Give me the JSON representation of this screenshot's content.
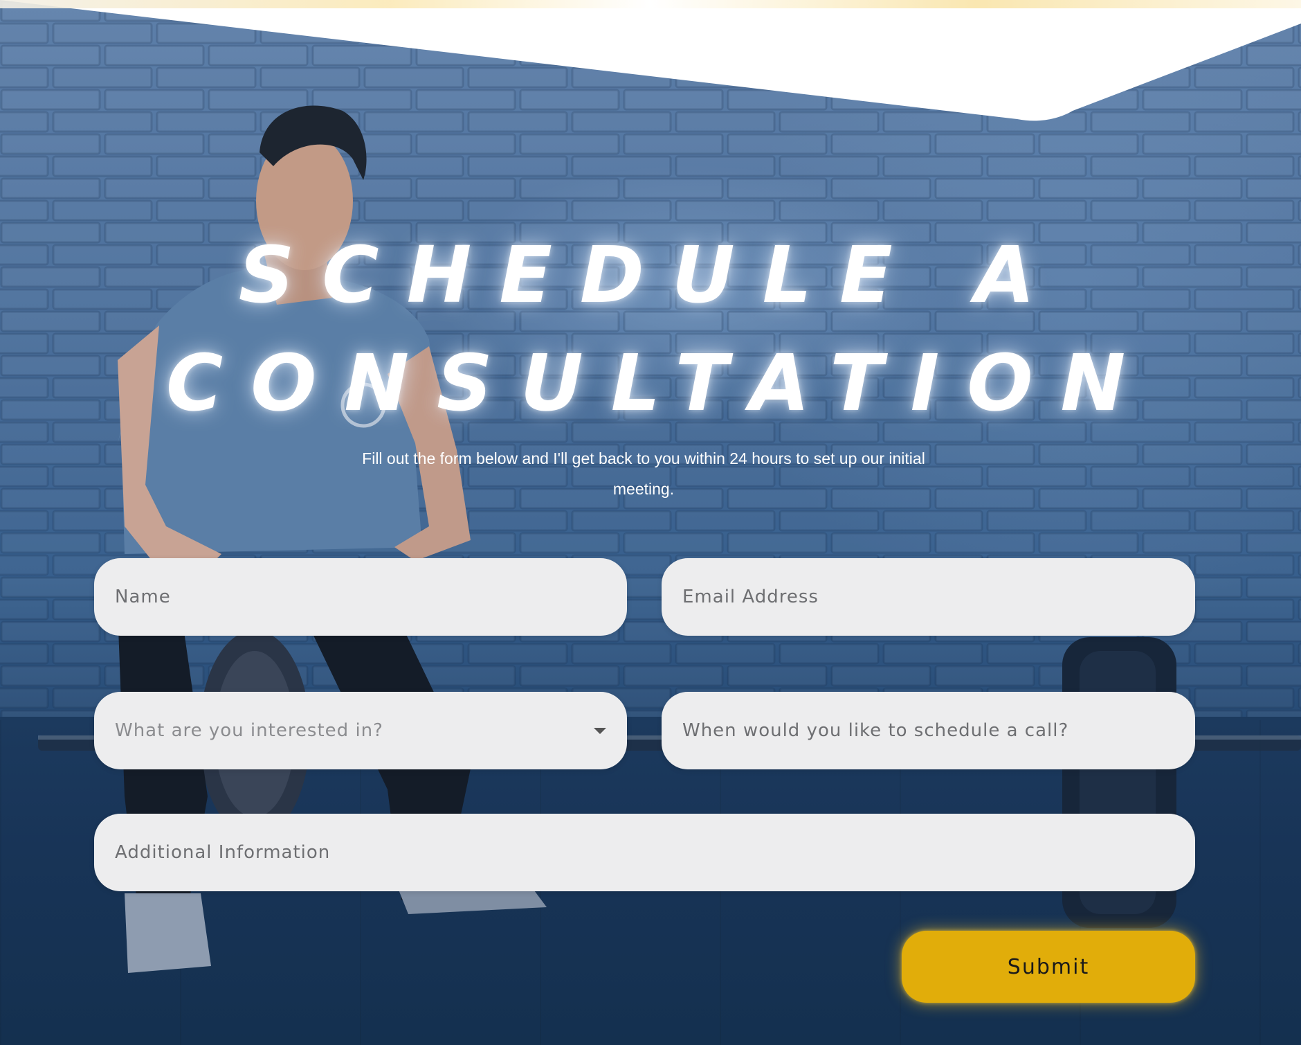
{
  "heading": {
    "line1": "SCHEDULE A",
    "line2": "CONSULTATION"
  },
  "subtitle": "Fill out the form below and I'll get back to you within 24 hours to set up our initial meeting.",
  "form": {
    "name_placeholder": "Name",
    "email_placeholder": "Email Address",
    "interest_placeholder": "What are you interested in?",
    "schedule_placeholder": "When would you like to schedule a call?",
    "additional_placeholder": "Additional Information",
    "submit_label": "Submit"
  },
  "colors": {
    "accent": "#e1ad0a",
    "field_bg": "#ededee",
    "overlay_blue": "#1b3b62"
  },
  "icons": {
    "interest_dropdown": "caret-down-icon"
  }
}
